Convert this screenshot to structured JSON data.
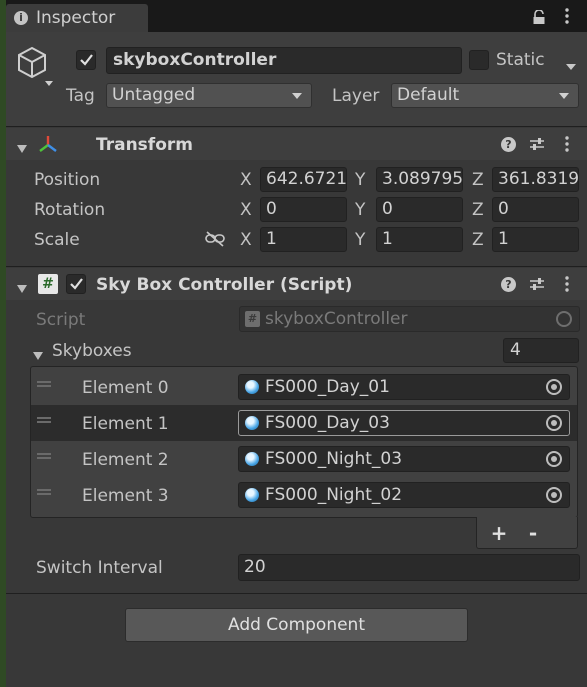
{
  "tab": {
    "title": "Inspector"
  },
  "gameobject": {
    "name": "skyboxController",
    "static_label": "Static",
    "tag_label": "Tag",
    "tag_value": "Untagged",
    "layer_label": "Layer",
    "layer_value": "Default"
  },
  "transform": {
    "title": "Transform",
    "rows": [
      {
        "label": "Position",
        "x": "642.6721",
        "y": "3.089795",
        "z": "361.8319"
      },
      {
        "label": "Rotation",
        "x": "0",
        "y": "0",
        "z": "0"
      },
      {
        "label": "Scale",
        "x": "1",
        "y": "1",
        "z": "1"
      }
    ],
    "axis": {
      "x": "X",
      "y": "Y",
      "z": "Z"
    }
  },
  "script_component": {
    "title": "Sky Box Controller (Script)",
    "script_label": "Script",
    "script_value": "skyboxController",
    "list_label": "Skyboxes",
    "list_size": "4",
    "elements": [
      {
        "label": "Element 0",
        "value": "FS000_Day_01"
      },
      {
        "label": "Element 1",
        "value": "FS000_Day_03"
      },
      {
        "label": "Element 2",
        "value": "FS000_Night_03"
      },
      {
        "label": "Element 3",
        "value": "FS000_Night_02"
      }
    ],
    "plus_label": "+",
    "minus_label": "-",
    "interval_label": "Switch Interval",
    "interval_value": "20"
  },
  "add_component": "Add Component",
  "colors": {
    "panel": "#383838",
    "header": "#3e3e3e",
    "field": "#2a2a2a",
    "accent_sphere": "#4aa7e8"
  }
}
